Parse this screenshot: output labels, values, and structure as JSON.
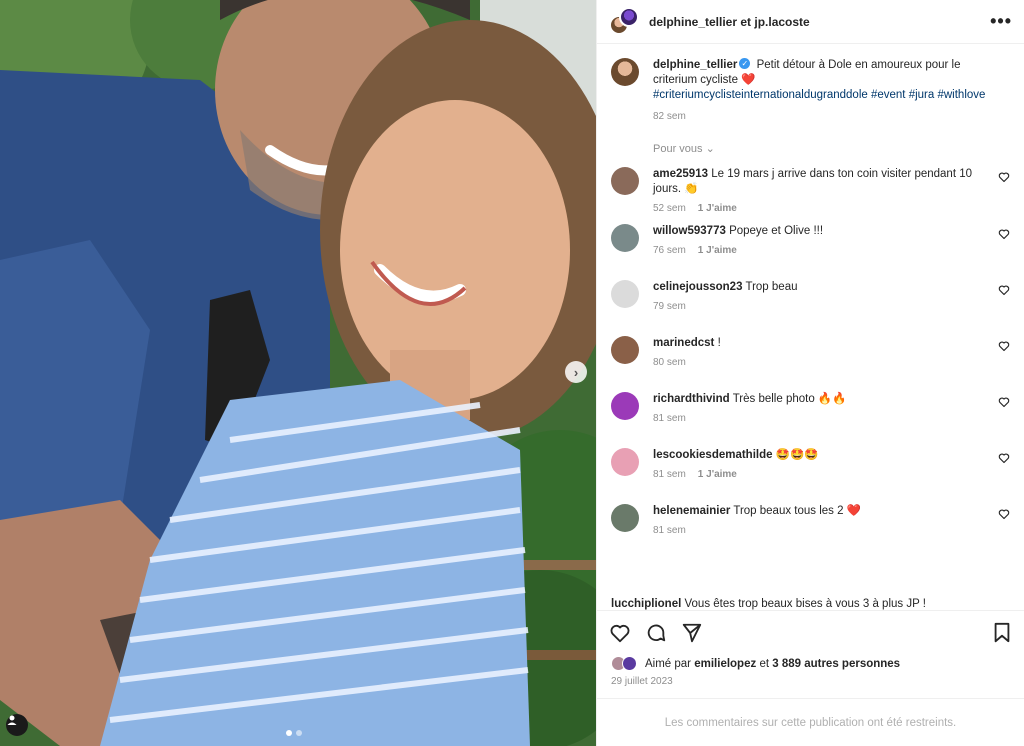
{
  "header": {
    "title": "delphine_tellier et jp.lacoste",
    "more_icon": "more-horizontal-icon"
  },
  "caption": {
    "username": "delphine_tellier",
    "text": "Petit détour à Dole en amoureux pour le criterium cycliste",
    "emoji": "❤️",
    "hashtags": "#criteriumcyclisteinternationaldugranddole #event #jura #withlove",
    "time": "82 sem"
  },
  "for_you": "Pour vous",
  "comments": [
    {
      "username": "ame25913",
      "text": "Le 19 mars j arrive dans ton coin visiter pendant 10 jours. 👏",
      "time": "52 sem",
      "likes": "1 J'aime",
      "avatar_color": "#8a6a5a"
    },
    {
      "username": "willow593773",
      "text": "Popeye et Olive !!!",
      "time": "76 sem",
      "likes": "1 J'aime",
      "avatar_color": "#7a8a8a"
    },
    {
      "username": "celinejousson23",
      "text": "Trop beau",
      "time": "79 sem",
      "likes": "",
      "avatar_color": "#dbdbdb"
    },
    {
      "username": "marinedcst",
      "text": "!",
      "time": "80 sem",
      "likes": "",
      "avatar_color": "#8a6048"
    },
    {
      "username": "richardthivind",
      "text": "Très belle photo 🔥🔥",
      "time": "81 sem",
      "likes": "",
      "avatar_color": "#9b3ab8"
    },
    {
      "username": "lescookiesdemathilde",
      "text": "🤩🤩🤩",
      "time": "81 sem",
      "likes": "1 J'aime",
      "avatar_color": "#e8a0b4"
    },
    {
      "username": "helenemainier",
      "text": "Trop beaux tous les 2 ❤️",
      "time": "81 sem",
      "likes": "",
      "avatar_color": "#6a7a6a"
    }
  ],
  "truncated_comment": {
    "username": "lucchiplionel",
    "text": "Vous êtes trop beaux bises à vous 3 à plus JP !"
  },
  "likes": {
    "prefix": "Aimé par",
    "user": "emilielopez",
    "middle": "et",
    "count": "3 889 autres personnes"
  },
  "date": "29 juillet 2023",
  "restricted": "Les commentaires sur cette publication ont été restreints.",
  "colors": {
    "accent": "#3897f0",
    "heart": "#ed4956",
    "text": "#262626",
    "muted": "#8e8e8e"
  }
}
